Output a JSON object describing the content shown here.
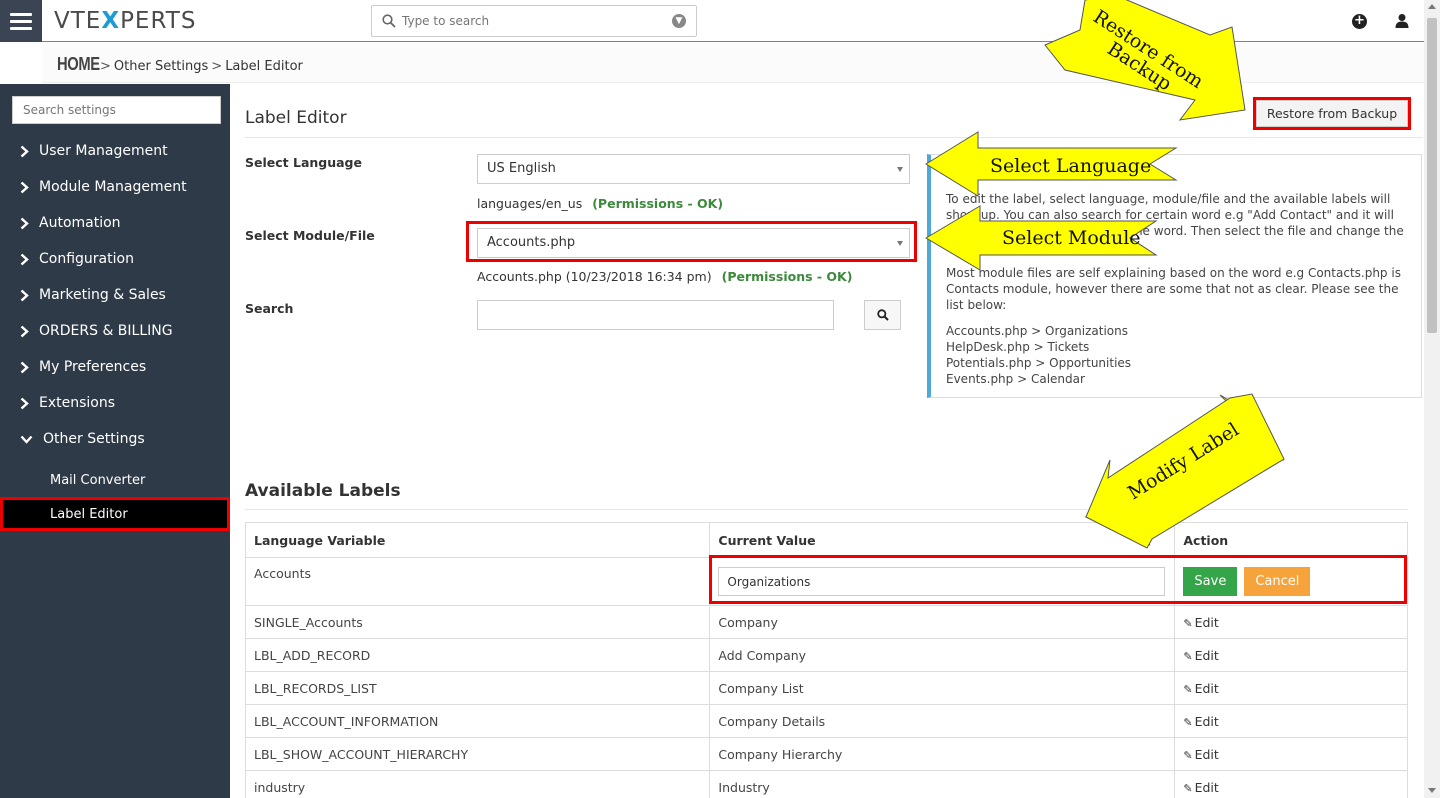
{
  "topbar": {
    "logo_left": "VTE",
    "logo_x": "X",
    "logo_right": "PERTS",
    "search_placeholder": "Type to search"
  },
  "breadcrumb": {
    "home": "HOME",
    "sep1": ">",
    "item1": "Other Settings",
    "sep2": ">",
    "item2": "Label Editor"
  },
  "sidebar": {
    "search_placeholder": "Search settings",
    "items": [
      {
        "label": "User Management"
      },
      {
        "label": "Module Management"
      },
      {
        "label": "Automation"
      },
      {
        "label": "Configuration"
      },
      {
        "label": "Marketing & Sales"
      },
      {
        "label": "ORDERS & BILLING"
      },
      {
        "label": "My Preferences"
      },
      {
        "label": "Extensions"
      },
      {
        "label": "Other Settings"
      }
    ],
    "subitems": [
      {
        "label": "Mail Converter"
      },
      {
        "label": "Label Editor"
      }
    ]
  },
  "main": {
    "title": "Label Editor",
    "restore_button": "Restore from Backup",
    "language_label": "Select Language",
    "language_value": "US English",
    "language_path": "languages/en_us",
    "language_perm": "(Permissions - OK)",
    "module_label": "Select Module/File",
    "module_value": "Accounts.php",
    "module_file_info": "Accounts.php (10/23/2018 16:34 pm)",
    "module_perm": "(Permissions - OK)",
    "search_label": "Search",
    "info": {
      "p1": "To edit the label, select language, module/file and the available labels will show up. You can also search for certain word e.g \"Add Contact\" and it will show all modules that contain the word. Then select the file and change the label.",
      "p2": "Most module files are self explaining based on the word e.g Contacts.php is Contacts module, however there are some that not as clear. Please see the list below:",
      "map1": "Accounts.php > Organizations",
      "map2": "HelpDesk.php > Tickets",
      "map3": "Potentials.php > Opportunities",
      "map4": "Events.php > Calendar"
    },
    "available_title": "Available Labels",
    "table": {
      "headers": [
        "Language Variable",
        "Current Value",
        "Action"
      ],
      "editing_row": {
        "variable": "Accounts",
        "value": "Organizations",
        "save": "Save",
        "cancel": "Cancel"
      },
      "rows": [
        {
          "variable": "SINGLE_Accounts",
          "value": "Company",
          "action": "Edit"
        },
        {
          "variable": "LBL_ADD_RECORD",
          "value": "Add Company",
          "action": "Edit"
        },
        {
          "variable": "LBL_RECORDS_LIST",
          "value": "Company List",
          "action": "Edit"
        },
        {
          "variable": "LBL_ACCOUNT_INFORMATION",
          "value": "Company Details",
          "action": "Edit"
        },
        {
          "variable": "LBL_SHOW_ACCOUNT_HIERARCHY",
          "value": "Company Hierarchy",
          "action": "Edit"
        },
        {
          "variable": "industry",
          "value": "Industry",
          "action": "Edit"
        }
      ]
    }
  },
  "callouts": {
    "restore_line1": "Restore from",
    "restore_line2": "Backup",
    "select_language": "Select Language",
    "select_module": "Select Module",
    "modify_label": "Modify Label"
  },
  "colors": {
    "sidebar_bg": "#2e3a47",
    "highlight_red": "#ee0000",
    "callout_yellow": "#ffff00",
    "save_green": "#35a54a",
    "cancel_orange": "#f7a33b",
    "permission_green": "#3c8a3c",
    "accent_orange": "#e45e2b"
  }
}
